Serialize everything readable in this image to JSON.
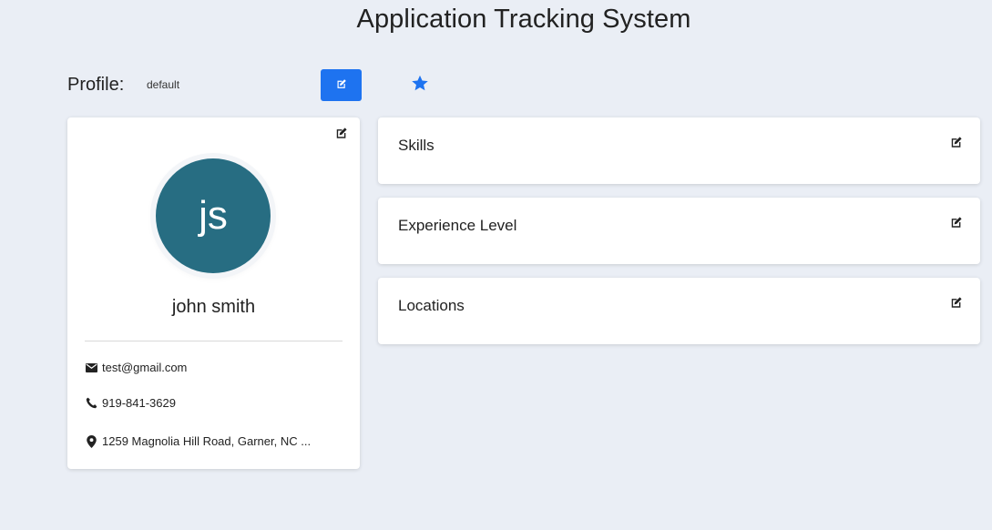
{
  "app": {
    "title": "Application Tracking System"
  },
  "profile_bar": {
    "label": "Profile:",
    "value": "default",
    "edit_icon": "edit-icon",
    "star_icon": "star-icon"
  },
  "profile_card": {
    "avatar_initials": "js",
    "name": "john smith",
    "email": "test@gmail.com",
    "phone": "919-841-3629",
    "address": "1259 Magnolia Hill Road, Garner, NC ...",
    "icons": {
      "edit": "edit-icon",
      "email": "envelope-icon",
      "phone": "phone-icon",
      "address": "map-marker-icon"
    }
  },
  "sections": [
    {
      "title": "Skills"
    },
    {
      "title": "Experience Level"
    },
    {
      "title": "Locations"
    }
  ],
  "colors": {
    "background": "#eaeef5",
    "primary": "#1e73f0",
    "avatar": "#276d82",
    "card": "#ffffff"
  }
}
